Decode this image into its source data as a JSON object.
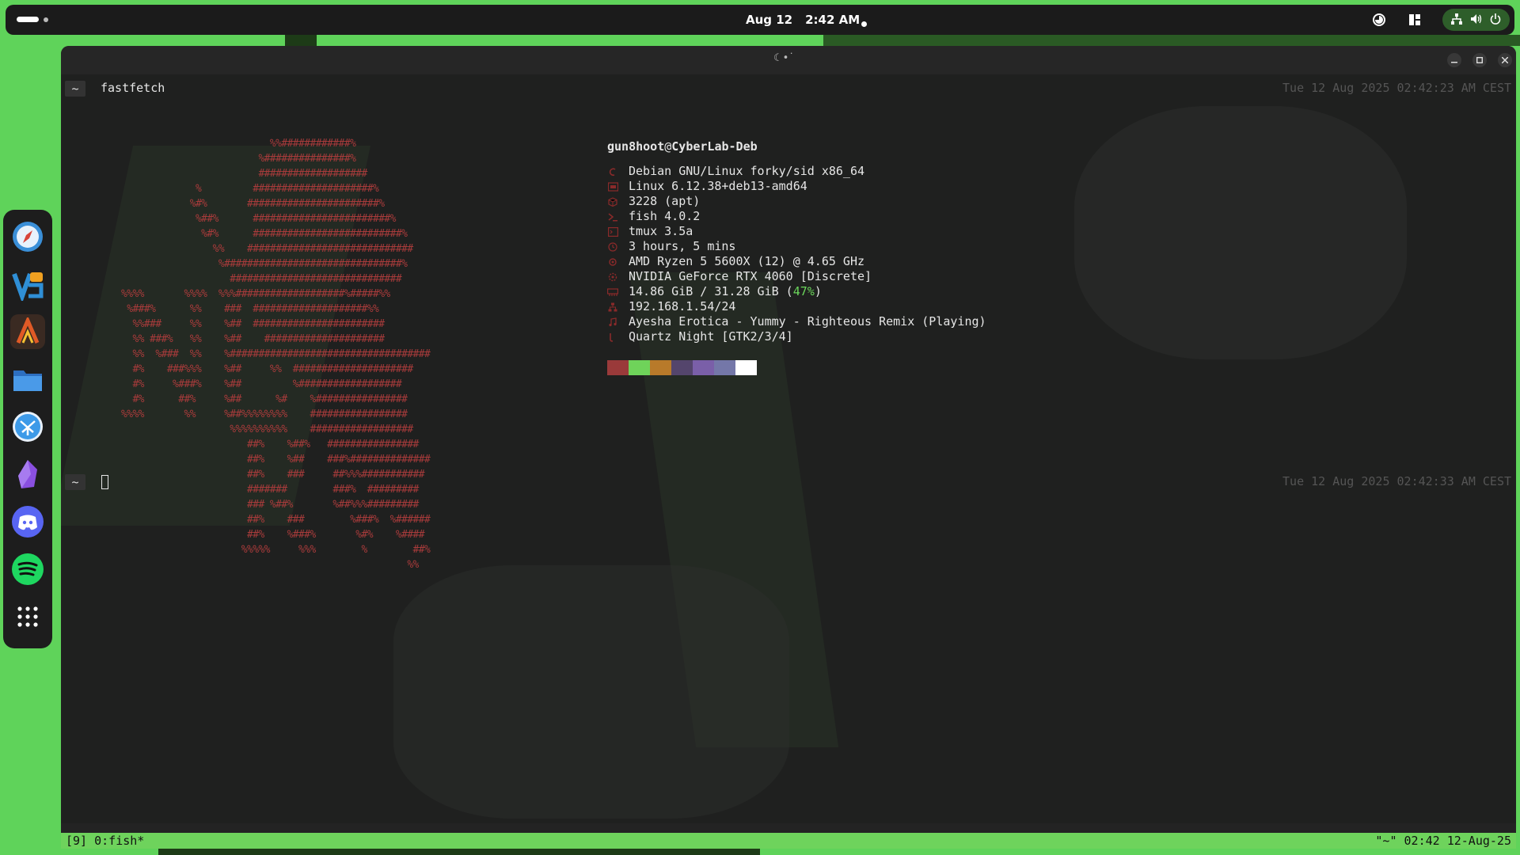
{
  "topbar": {
    "date": "Aug 12",
    "time": "2:42 AM"
  },
  "dock": {
    "apps": [
      {
        "name": "Safari-like browser",
        "icon": "compass-icon",
        "color": "#3a8fd8"
      },
      {
        "name": "Visual Studio Code",
        "icon": "code-editor-icon",
        "color": "#2f8fd6"
      },
      {
        "name": "Alacritty",
        "icon": "terminal-a-icon",
        "color": "#e05a26"
      },
      {
        "name": "Files",
        "icon": "folder-icon",
        "color": "#3b8be0"
      },
      {
        "name": "KDE Connect",
        "icon": "kde-icon",
        "color": "#3d9ae8"
      },
      {
        "name": "Obsidian",
        "icon": "obsidian-icon",
        "color": "#8a4fe0"
      },
      {
        "name": "Discord",
        "icon": "discord-icon",
        "color": "#5865f2"
      },
      {
        "name": "Spotify",
        "icon": "spotify-icon",
        "color": "#1ed760"
      },
      {
        "name": "Show Apps",
        "icon": "app-grid-icon",
        "color": "#ffffff"
      }
    ]
  },
  "terminal": {
    "title": "☾•˙",
    "first_prompt": {
      "dir": "~",
      "command": "fastfetch",
      "timestamp": "Tue 12 Aug 2025 02:42:23 AM CEST"
    },
    "second_prompt": {
      "dir": "~",
      "timestamp": "Tue 12 Aug 2025 02:42:33 AM CEST"
    },
    "ascii_art": "                          %%############%\n                        %###############%\n                        ###################\n             %         #####################%\n            %#%       #######################%\n             %##%      ########################%\n              %#%      ##########################%\n                %%    #############################\n                 %###############################%\n                   ##############################\n%%%%       %%%%  %%%###################%#####%%\n %###%      %%    ###  ####################%%\n  %%###     %%    %##  #######################\n  %% ###%   %%    %##    #####################\n  %%  %###  %%    %###################################\n  #%    ###%%%    %##     %%  #####################\n  #%     %###%    %##         %##################\n  #%      ##%     %##      %#    %################\n%%%%       %%     %##%%%%%%%%    #################\n                   %%%%%%%%%%    ##################\n                      ##%    %##%   ################\n                      ##%    %##    ###%##############\n                      ##%    ###     ##%%%###########\n                      #######        ###%  #########\n                      ### %##%       %##%%%#########\n                      ##%    ###        %###%  %######\n                      ##%    %###%       %#%    %####\n                     %%%%%     %%%        %        ##%\n                                                  %%",
    "user": "gun8hoot",
    "at": "@",
    "host": "CyberLab-Deb",
    "info": [
      {
        "icon": "debian-icon",
        "text": "Debian GNU/Linux forky/sid x86_64"
      },
      {
        "icon": "kernel-icon",
        "text": "Linux 6.12.38+deb13-amd64"
      },
      {
        "icon": "package-icon",
        "text": "3228 (apt)"
      },
      {
        "icon": "shell-icon",
        "text": "fish 4.0.2"
      },
      {
        "icon": "terminal-icon",
        "text": "tmux 3.5a"
      },
      {
        "icon": "clock-icon",
        "text": "3 hours, 5 mins"
      },
      {
        "icon": "cpu-icon",
        "text": "AMD Ryzen 5 5600X (12) @ 4.65 GHz"
      },
      {
        "icon": "gpu-icon",
        "text": "NVIDIA GeForce RTX 4060 [Discrete]"
      },
      {
        "icon": "memory-icon",
        "text": "14.86 GiB / 31.28 GiB (",
        "pct": "47%",
        "after": ")"
      },
      {
        "icon": "network-icon",
        "text": "192.168.1.54/24"
      },
      {
        "icon": "music-note-icon",
        "text": "Ayesha Erotica - Yummy - Righteous Remix (Playing)"
      },
      {
        "icon": "theme-icon",
        "text": "Quartz Night [GTK2/3/4]"
      }
    ],
    "palette": [
      "#9a3a3a",
      "#6fd35a",
      "#b87a2a",
      "#54456c",
      "#7a5fa8",
      "#7477a8",
      "#ffffff"
    ]
  },
  "tmux": {
    "left": "[9] 0:fish*",
    "right": "\"~\" 02:42 12-Aug-25"
  }
}
